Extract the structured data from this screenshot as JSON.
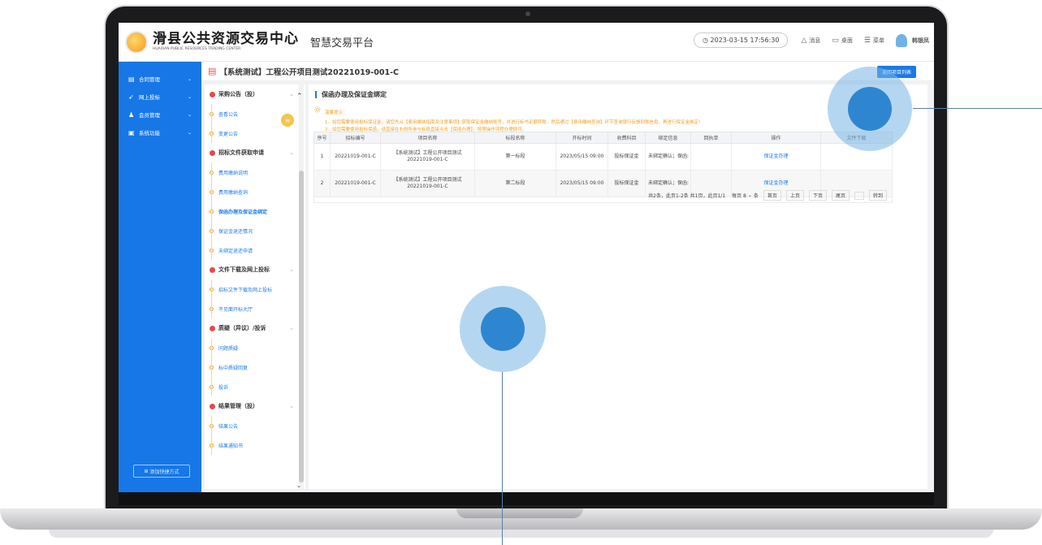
{
  "header": {
    "logo_cn": "滑县公共资源交易中心",
    "logo_en": "HUAXIAN PUBLIC RESOURCES TRADING CENTER",
    "platform": "智慧交易平台",
    "datetime": "2023-03-15 17:56:30",
    "messages": "消息",
    "desktop": "桌面",
    "menu": "菜单",
    "user": "韩银凤"
  },
  "sidebar": {
    "items": [
      {
        "label": "合同管理",
        "icon": "contract-icon"
      },
      {
        "label": "网上投标",
        "icon": "bid-icon"
      },
      {
        "label": "会员管理",
        "icon": "member-icon"
      },
      {
        "label": "系统功能",
        "icon": "system-icon"
      }
    ],
    "add_contact": "添加快捷方式"
  },
  "titlebar": {
    "title": "【系统测试】工程公开项目测试20221019-001-C",
    "back_button": "返回项目列表"
  },
  "leftnav": {
    "sections": [
      {
        "label": "采购公告（投）",
        "items": [
          "查看公告",
          "变更公告"
        ]
      },
      {
        "label": "招标文件获取申请",
        "items": [
          "费用缴纳说明",
          "费用缴纳查询",
          "保函办理及保证金绑定",
          "保证金退还情况",
          "未绑定退还申请"
        ]
      },
      {
        "label": "文件下载及网上投标",
        "items": [
          "招标文件下载及网上投标",
          "不见面开标大厅"
        ]
      },
      {
        "label": "质疑（异议）/投诉",
        "items": [
          "问题质疑",
          "标中质疑回复",
          "投诉"
        ]
      },
      {
        "label": "结果管理（投）",
        "items": [
          "结果公告",
          "结果通知书"
        ]
      }
    ]
  },
  "main": {
    "section_title": "保函办理及保证金绑定",
    "tip_title": "温馨提示：",
    "tip_line1": "1．如您需要使用投标保证金，请您先从【费用缴纳指南及注意事项】获取保证金缴纳账号，并进行标书足额转账，然后通过【费用缴纳查询】环节查询银行反馈到账信息，再进行保证金绑定！",
    "tip_line2": "2．如您需要使用投标保函，请直接在右侧所参与标段直接点击【保函办理】，按照操作流程办理即可。",
    "columns": [
      "序号",
      "招标编号",
      "项目名称",
      "标段名称",
      "开标时间",
      "收费科目",
      "绑定信息",
      "回执单",
      "操作",
      "文件下载"
    ],
    "rows": [
      {
        "no": "1",
        "code": "20221019-001-C",
        "project": "【系统测试】工程公开项目测试20221019-001-C",
        "section": "第一标段",
        "open_time": "2023/05/15 09:00",
        "fee": "投标保证金",
        "bind": "未绑定确认；保函:",
        "receipt": "",
        "op": "保证金办理",
        "download": ""
      },
      {
        "no": "2",
        "code": "20221019-001-C",
        "project": "【系统测试】工程公开项目测试20221019-001-C",
        "section": "第二标段",
        "open_time": "2023/05/15 09:00",
        "fee": "投标保证金",
        "bind": "未绑定确认；保函:",
        "receipt": "",
        "op": "保证金办理",
        "download": ""
      }
    ],
    "pager": {
      "summary": "共2条，此页1-2条 共1页，此页1/1",
      "per_page": "每页 8",
      "unit": "条",
      "first": "首页",
      "prev": "上页",
      "next": "下页",
      "last": "尾页",
      "goto": "转到"
    }
  },
  "colors": {
    "sidebar": "#1777e6",
    "accent": "#1a7ae8",
    "tip": "#f0a020",
    "marker": "#2f86d0"
  }
}
